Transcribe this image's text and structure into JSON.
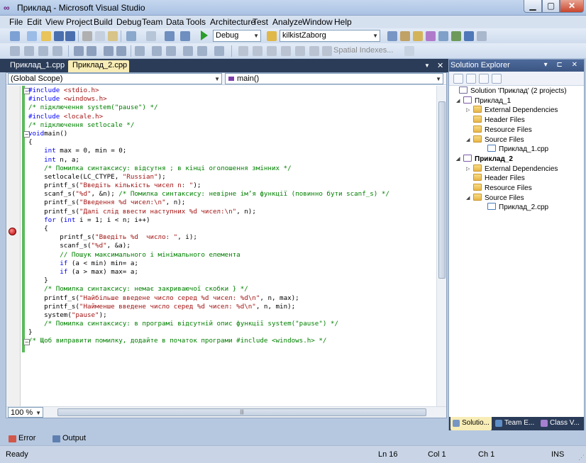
{
  "window": {
    "title": "Приклад - Microsoft Visual Studio",
    "buttons": {
      "minimize": "▁",
      "maximize": "▢",
      "close": "✕"
    }
  },
  "menu": [
    "File",
    "Edit",
    "View",
    "Project",
    "Build",
    "Debug",
    "Team",
    "Data",
    "Tools",
    "Architecture",
    "Test",
    "Analyze",
    "Window",
    "Help"
  ],
  "toolbar": {
    "configuration": "Debug",
    "find_combo": "kilkistZaborg",
    "spatial_indexes": "Spatial Indexes..."
  },
  "doc_tabs": [
    {
      "label": "Приклад_1.cpp",
      "active": false
    },
    {
      "label": "Приклад_2.cpp",
      "active": true,
      "close": "✕"
    }
  ],
  "editor": {
    "scope": "(Global Scope)",
    "member": "main()",
    "zoom": "100 %",
    "code_lines": [
      [
        [
          "kw",
          "#include "
        ],
        [
          "st",
          "<stdio.h>"
        ]
      ],
      [
        [
          "kw",
          "#include "
        ],
        [
          "st",
          "<windows.h>"
        ]
      ],
      [
        [
          "cm",
          "/* підключення system(\"pause\") */"
        ]
      ],
      [
        [
          "kw",
          "#include "
        ],
        [
          "st",
          "<locale.h>"
        ]
      ],
      [
        [
          "cm",
          "/* підключення setlocale */"
        ]
      ],
      [
        [
          "kw",
          "void"
        ],
        [
          "",
          "main()"
        ]
      ],
      [
        [
          "",
          "{"
        ]
      ],
      [
        [
          "",
          "    "
        ],
        [
          "kw",
          "int"
        ],
        [
          "",
          "",
          " max = 0, min = 0;"
        ]
      ],
      [
        [
          "",
          "    "
        ],
        [
          "kw",
          "int"
        ],
        [
          "",
          "",
          " n, a;"
        ]
      ],
      [
        [
          "",
          "    "
        ],
        [
          "cm",
          "/* Помилка синтаксису: відсутня ; в кінці оголошення змінних */"
        ]
      ],
      [
        [
          "",
          "    setlocale(LC_CTYPE, "
        ],
        [
          "st",
          "\"Russian\""
        ],
        [
          "",
          ");"
        ]
      ],
      [
        [
          "",
          "    printf_s("
        ],
        [
          "st",
          "\"Введіть кількість чисел n: \""
        ],
        [
          "",
          ");"
        ]
      ],
      [
        [
          "",
          "    scanf_s("
        ],
        [
          "st",
          "\"%d\""
        ],
        [
          "",
          ", &n); "
        ],
        [
          "cm",
          "/* Помилка синтаксису: невірне ім’я функції (повинно бути scanf_s) */"
        ]
      ],
      [
        [
          "",
          "    printf_s("
        ],
        [
          "st",
          "\"Введення %d чисел:\\n\""
        ],
        [
          "",
          ", n);"
        ]
      ],
      [
        [
          "",
          "    printf_s("
        ],
        [
          "st",
          "\"Далі слід ввести наступних %d чисел:\\n\""
        ],
        [
          "",
          ", n);"
        ]
      ],
      [
        [
          "",
          "    "
        ],
        [
          "kw",
          "for"
        ],
        [
          "",
          " ("
        ],
        [
          "kw",
          "int"
        ],
        [
          "",
          " i = 1; i < n; i++)"
        ]
      ],
      [
        [
          "",
          "    {"
        ]
      ],
      [
        [
          "",
          "        printf_s("
        ],
        [
          "st",
          "\"Введіть %d  число: \""
        ],
        [
          "",
          ", i);"
        ]
      ],
      [
        [
          "",
          "        scanf_s("
        ],
        [
          "st",
          "\"%d\""
        ],
        [
          "",
          ", &a);"
        ]
      ],
      [
        [
          "",
          "        "
        ],
        [
          "cm",
          "// Пошук максимального і мінімального елемента"
        ]
      ],
      [
        [
          "",
          "        "
        ],
        [
          "kw",
          "if"
        ],
        [
          "",
          " (a < min) min= a;"
        ]
      ],
      [
        [
          "",
          "        "
        ],
        [
          "kw",
          "if"
        ],
        [
          "",
          " (a > max) max= a;"
        ]
      ],
      [
        [
          "",
          "    }"
        ]
      ],
      [
        [
          "",
          "    "
        ],
        [
          "cm",
          "/* Помилка синтаксису: немає закриваючої скобки } */"
        ]
      ],
      [
        [
          "",
          "    printf_s("
        ],
        [
          "st",
          "\"Найбільше введене число серед %d чисел: %d\\n\""
        ],
        [
          "",
          ", n, max);"
        ]
      ],
      [
        [
          "",
          "    printf_s("
        ],
        [
          "st",
          "\"Найменше введене число серед %d чисел: %d\\n\""
        ],
        [
          "",
          ", n, min);"
        ]
      ],
      [
        [
          "",
          "    system("
        ],
        [
          "st",
          "\"pause\""
        ],
        [
          "",
          ");"
        ]
      ],
      [
        [
          "",
          "    "
        ],
        [
          "cm",
          "/* Помилка синтаксису: в програмі відсутній опис функції system(\"pause\") */"
        ]
      ],
      [
        [
          "",
          "}"
        ]
      ],
      [
        [
          "cm",
          "/* Щоб виправити помилку, додайте в початок програми #include <windows.h> */"
        ]
      ]
    ]
  },
  "solution_explorer": {
    "title": "Solution Explorer",
    "header_buttons": "▾ ⊏ ✕",
    "tree": [
      {
        "label": "Solution 'Приклад' (2 projects)",
        "icon": "solution-icon",
        "indent": 0,
        "twisty": ""
      },
      {
        "label": "Приклад_1",
        "icon": "project-icon",
        "indent": 1,
        "twisty": "◢"
      },
      {
        "label": "External Dependencies",
        "icon": "folder-icon",
        "indent": 2,
        "twisty": "▷"
      },
      {
        "label": "Header Files",
        "icon": "folder-icon",
        "indent": 2,
        "twisty": ""
      },
      {
        "label": "Resource Files",
        "icon": "folder-icon",
        "indent": 2,
        "twisty": ""
      },
      {
        "label": "Source Files",
        "icon": "folder-open-icon",
        "indent": 2,
        "twisty": "◢"
      },
      {
        "label": "Приклад_1.cpp",
        "icon": "cpp-file-icon",
        "indent": 3,
        "twisty": ""
      },
      {
        "label": "Приклад_2",
        "icon": "project-icon",
        "indent": 1,
        "twisty": "◢",
        "bold": true
      },
      {
        "label": "External Dependencies",
        "icon": "folder-icon",
        "indent": 2,
        "twisty": "▷"
      },
      {
        "label": "Header Files",
        "icon": "folder-icon",
        "indent": 2,
        "twisty": ""
      },
      {
        "label": "Resource Files",
        "icon": "folder-icon",
        "indent": 2,
        "twisty": ""
      },
      {
        "label": "Source Files",
        "icon": "folder-open-icon",
        "indent": 2,
        "twisty": "◢"
      },
      {
        "label": "Приклад_2.cpp",
        "icon": "cpp-file-icon",
        "indent": 3,
        "twisty": ""
      }
    ],
    "tabs": [
      "Solutio...",
      "Team E...",
      "Class V..."
    ]
  },
  "output_tabs": [
    "Error List",
    "Output"
  ],
  "status": {
    "state": "Ready",
    "line": "Ln 16",
    "col": "Col 1",
    "ch": "Ch 1",
    "mode": "INS"
  },
  "colors": {
    "titlebar": "#b9cde9",
    "editor_bg": "#ffffff",
    "keyword": "#0000ff",
    "comment": "#008000",
    "string": "#a31515",
    "active_tab": "#f8edb6",
    "tab_strip": "#2b3c59"
  }
}
